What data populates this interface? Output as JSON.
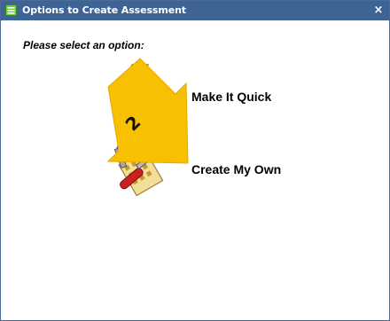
{
  "dialog": {
    "title": "Options to Create Assessment",
    "close_glyph": "×",
    "prompt": "Please select an option:"
  },
  "options": [
    {
      "label": "Make It Quick",
      "icon": "lightning-bolt-icon"
    },
    {
      "label": "Create My Own",
      "icon": "tools-worksheet-icon"
    }
  ],
  "callout": {
    "number": "2",
    "color": "#f7c000"
  },
  "colors": {
    "titlebar": "#3d6494",
    "border": "#4a6b95"
  }
}
